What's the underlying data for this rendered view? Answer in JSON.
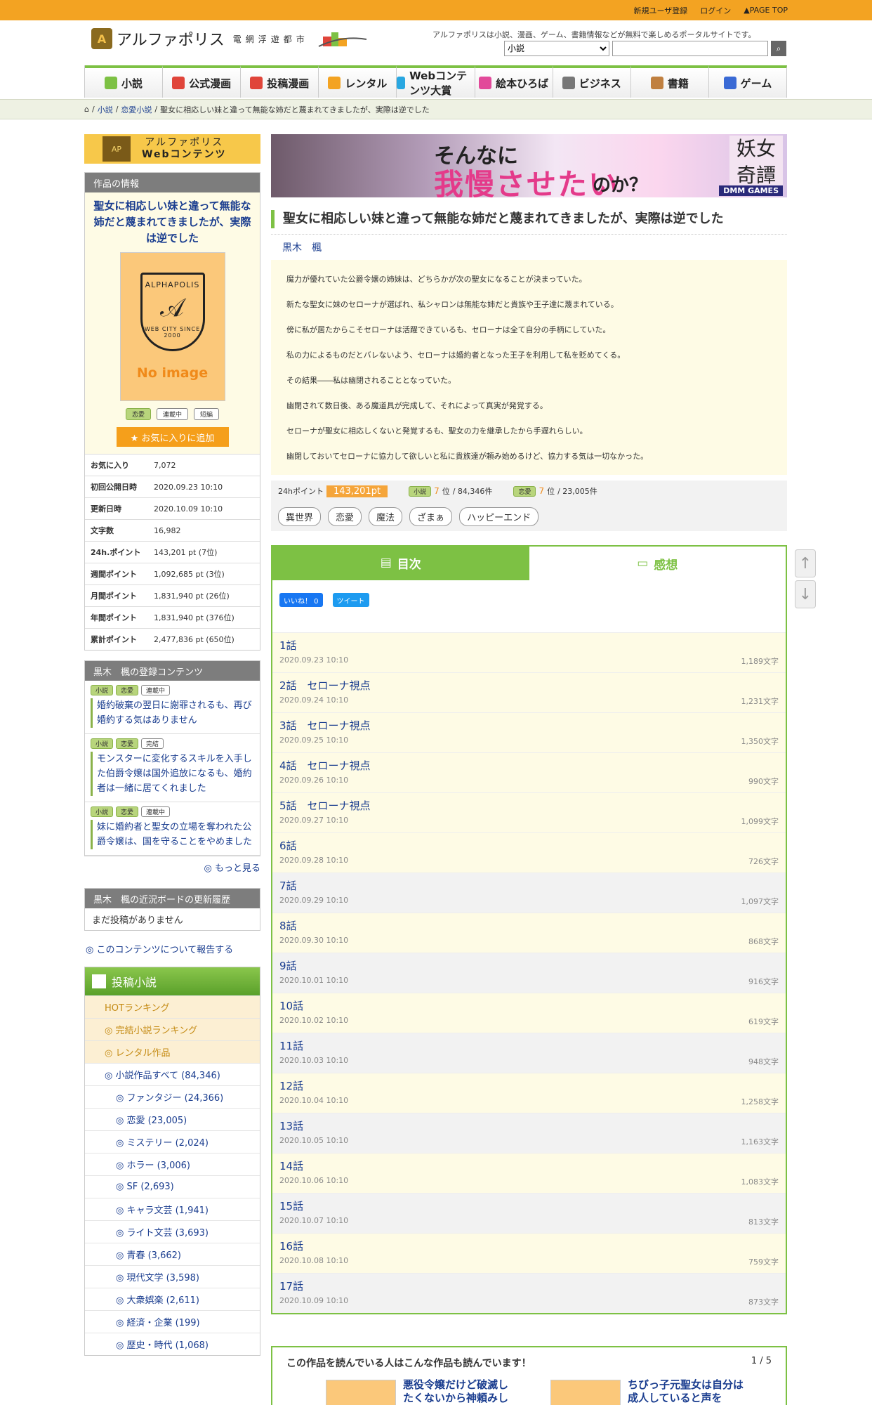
{
  "topbar": {
    "register": "新規ユーザ登録",
    "login": "ログイン",
    "pagetop": "▲PAGE TOP"
  },
  "header": {
    "logo": "アルファポリス",
    "logo_sub": "電網浮遊都市",
    "tagline": "アルファポリスは小説、漫画、ゲーム、書籍情報などが無料で楽しめるポータルサイトです。",
    "search_select": "小説"
  },
  "gnav": [
    {
      "label": "小説",
      "color": "#7dc144"
    },
    {
      "label": "公式漫画",
      "color": "#e0453a"
    },
    {
      "label": "投稿漫画",
      "color": "#e0453a"
    },
    {
      "label": "レンタル",
      "color": "#f3a322"
    },
    {
      "label": "Webコンテンツ大賞",
      "color": "#29a7e1"
    },
    {
      "label": "絵本ひろば",
      "color": "#e24a9a"
    },
    {
      "label": "ビジネス",
      "color": "#777777"
    },
    {
      "label": "書籍",
      "color": "#c08040"
    },
    {
      "label": "ゲーム",
      "color": "#3a6ad5"
    }
  ],
  "breadcrumb": {
    "home": "⌂",
    "c1": "小説",
    "sep": "/",
    "c2": "恋愛小説",
    "current": "聖女に相応しい妹と違って無能な姉だと蔑まれてきましたが、実際は逆でした"
  },
  "sidebar": {
    "webc_logo": "AP",
    "webc_line1": "アルファポリス",
    "webc_line2": "Webコンテンツ",
    "info_header": "作品の情報",
    "title": "聖女に相応しい妹と違って無能な姉だと蔑まれてきましたが、実際は逆でした",
    "noimage_brand": "ALPHAPOLIS",
    "noimage_city": "WEB CITY SINCE 2000",
    "noimage_text": "No image",
    "tags": [
      "恋愛",
      "連載中",
      "短編"
    ],
    "fav_button": "★ お気に入りに追加",
    "stats": [
      {
        "k": "お気に入り",
        "v": "7,072"
      },
      {
        "k": "初回公開日時",
        "v": "2020.09.23 10:10"
      },
      {
        "k": "更新日時",
        "v": "2020.10.09 10:10"
      },
      {
        "k": "文字数",
        "v": "16,982"
      },
      {
        "k": "24h.ポイント",
        "v": "143,201 pt (7位)"
      },
      {
        "k": "週間ポイント",
        "v": "1,092,685 pt (3位)"
      },
      {
        "k": "月間ポイント",
        "v": "1,831,940 pt (26位)"
      },
      {
        "k": "年間ポイント",
        "v": "1,831,940 pt (376位)"
      },
      {
        "k": "累計ポイント",
        "v": "2,477,836 pt (650位)"
      }
    ],
    "reg_header": "黒木　楓の登録コンテンツ",
    "reg_items": [
      {
        "tags": [
          "小説",
          "恋愛",
          "連載中"
        ],
        "title": "婚約破棄の翌日に謝罪されるも、再び婚約する気はありません"
      },
      {
        "tags": [
          "小説",
          "恋愛",
          "完結"
        ],
        "title": "モンスターに変化するスキルを入手した伯爵令嬢は国外追放になるも、婚約者は一緒に居てくれました"
      },
      {
        "tags": [
          "小説",
          "恋愛",
          "連載中"
        ],
        "title": "妹に婚約者と聖女の立場を奪われた公爵令嬢は、国を守ることをやめました"
      }
    ],
    "more": "◎ もっと見る",
    "board_header": "黒木　楓の近況ボードの更新履歴",
    "board_text": "まだ投稿がありません",
    "report": "◎ このコンテンツについて報告する",
    "toko_header": "投稿小説",
    "toko_items": [
      {
        "label": "HOTランキング",
        "type": "o"
      },
      {
        "label": "◎ 完結小説ランキング",
        "type": "o"
      },
      {
        "label": "◎ レンタル作品",
        "type": "o"
      },
      {
        "label": "◎ 小説作品すべて (84,346)",
        "type": "n"
      },
      {
        "label": "◎ ファンタジー (24,366)",
        "type": "s"
      },
      {
        "label": "◎ 恋愛 (23,005)",
        "type": "s"
      },
      {
        "label": "◎ ミステリー (2,024)",
        "type": "s"
      },
      {
        "label": "◎ ホラー (3,006)",
        "type": "s"
      },
      {
        "label": "◎ SF (2,693)",
        "type": "s"
      },
      {
        "label": "◎ キャラ文芸 (1,941)",
        "type": "s"
      },
      {
        "label": "◎ ライト文芸 (3,693)",
        "type": "s"
      },
      {
        "label": "◎ 青春 (3,662)",
        "type": "s"
      },
      {
        "label": "◎ 現代文学 (3,598)",
        "type": "s"
      },
      {
        "label": "◎ 大衆娯楽 (2,611)",
        "type": "s"
      },
      {
        "label": "◎ 経済・企業 (199)",
        "type": "s"
      },
      {
        "label": "◎ 歴史・時代 (1,068)",
        "type": "s"
      }
    ]
  },
  "banner": {
    "line1": "そんなに",
    "line2": "我慢させたい",
    "line3": "のか？",
    "logo": "妖女 奇譚",
    "games": "DMM GAMES"
  },
  "work": {
    "title": "聖女に相応しい妹と違って無能な姉だと蔑まれてきましたが、実際は逆でした",
    "author": "黒木　楓",
    "summary": [
      "魔力が優れていた公爵令嬢の姉妹は、どちらかが次の聖女になることが決まっていた。",
      "新たな聖女に妹のセローナが選ばれ、私シャロンは無能な姉だと貴族や王子達に蔑まれている。",
      "傍に私が居たからこそセローナは活躍できているも、セローナは全て自分の手柄にしていた。",
      "私の力によるものだとバレないよう、セローナは婚約者となった王子を利用して私を貶めてくる。",
      "その結果――私は幽閉されることとなっていた。",
      "幽閉されて数日後、ある魔道具が完成して、それによって真実が発覚する。",
      "セローナが聖女に相応しくないと発覚するも、聖女の力を継承したから手遅れらしい。",
      "幽閉しておいてセローナに協力して欲しいと私に貴族達が頼み始めるけど、協力する気は一切なかった。"
    ],
    "pts_label": "24hポイント",
    "pts_value": "143,201pt",
    "rank1_tag": "小説",
    "rank1_rank": "7",
    "rank1_unit": "位",
    "rank1_total": "/ 84,346件",
    "rank2_tag": "恋愛",
    "rank2_rank": "7",
    "rank2_unit": "位",
    "rank2_total": "/ 23,005件",
    "genres": [
      "異世界",
      "恋愛",
      "魔法",
      "ざまぁ",
      "ハッピーエンド"
    ]
  },
  "toc": {
    "tab_toc": "目次",
    "tab_review": "感想",
    "like": "いいね！ 0",
    "tweet": "ツイート",
    "episodes": [
      {
        "t": "1話",
        "d": "2020.09.23 10:10",
        "c": "1,189文字"
      },
      {
        "t": "2話　セローナ視点",
        "d": "2020.09.24 10:10",
        "c": "1,231文字"
      },
      {
        "t": "3話　セローナ視点",
        "d": "2020.09.25 10:10",
        "c": "1,350文字"
      },
      {
        "t": "4話　セローナ視点",
        "d": "2020.09.26 10:10",
        "c": "990文字"
      },
      {
        "t": "5話　セローナ視点",
        "d": "2020.09.27 10:10",
        "c": "1,099文字"
      },
      {
        "t": "6話",
        "d": "2020.09.28 10:10",
        "c": "726文字"
      },
      {
        "t": "7話",
        "d": "2020.09.29 10:10",
        "c": "1,097文字"
      },
      {
        "t": "8話",
        "d": "2020.09.30 10:10",
        "c": "868文字"
      },
      {
        "t": "9話",
        "d": "2020.10.01 10:10",
        "c": "916文字"
      },
      {
        "t": "10話",
        "d": "2020.10.02 10:10",
        "c": "619文字"
      },
      {
        "t": "11話",
        "d": "2020.10.03 10:10",
        "c": "948文字"
      },
      {
        "t": "12話",
        "d": "2020.10.04 10:10",
        "c": "1,258文字"
      },
      {
        "t": "13話",
        "d": "2020.10.05 10:10",
        "c": "1,163文字"
      },
      {
        "t": "14話",
        "d": "2020.10.06 10:10",
        "c": "1,083文字"
      },
      {
        "t": "15話",
        "d": "2020.10.07 10:10",
        "c": "813文字"
      },
      {
        "t": "16話",
        "d": "2020.10.08 10:10",
        "c": "759文字"
      },
      {
        "t": "17話",
        "d": "2020.10.09 10:10",
        "c": "873文字"
      }
    ]
  },
  "rec": {
    "header": "この作品を読んでいる人はこんな作品も読んでいます！",
    "page": "1 / 5",
    "t1": "悪役令嬢だけど破滅したくないから神頼みし",
    "t2": "ちびっ子元聖女は自分は成人していると声を"
  }
}
